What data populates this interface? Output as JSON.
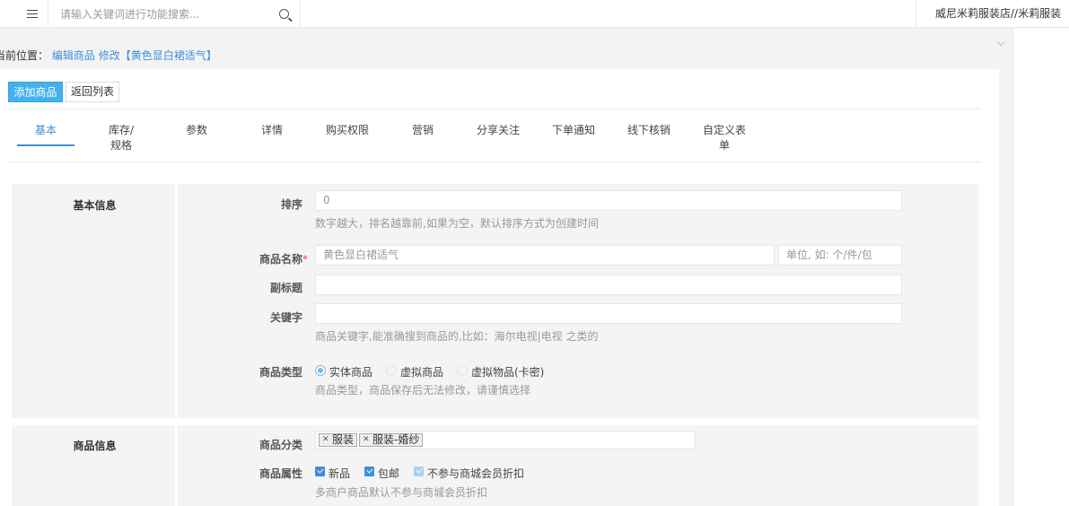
{
  "header": {
    "search_placeholder": "请输入关键词进行功能搜索...",
    "shop_name": "威尼米莉服装店//米莉服装"
  },
  "breadcrumb": {
    "prefix": "当前位置：",
    "link1": "编辑商品",
    "link2": "修改【黄色显白裙适气】"
  },
  "toolbar": {
    "add_label": "添加商品",
    "back_label": "返回列表"
  },
  "tabs": [
    {
      "label": "基本",
      "active": true
    },
    {
      "label": "库存/规格"
    },
    {
      "label": "参数"
    },
    {
      "label": "详情"
    },
    {
      "label": "购买权限"
    },
    {
      "label": "营销"
    },
    {
      "label": "分享关注"
    },
    {
      "label": "下单通知"
    },
    {
      "label": "线下核销"
    },
    {
      "label": "自定义表单"
    }
  ],
  "basic": {
    "title": "基本信息",
    "sort_label": "排序",
    "sort_value": "0",
    "sort_help": "数字越大，排名越靠前,如果为空，默认排序方式为创建时间",
    "name_label": "商品名称",
    "name_required": "*",
    "name_value": "黄色显白裙适气",
    "unit_placeholder": "单位, 如: 个/件/包",
    "subtitle_label": "副标题",
    "subtitle_value": "",
    "keyword_label": "关键字",
    "keyword_value": "",
    "keyword_help": "商品关键字,能准确搜到商品的,比如：海尔电视|电视 之类的",
    "type_label": "商品类型",
    "type_options": [
      "实体商品",
      "虚拟商品",
      "虚拟物品(卡密)"
    ],
    "type_selected": "实体商品",
    "type_help": "商品类型，商品保存后无法修改，请谨慎选择"
  },
  "goods_info": {
    "title": "商品信息",
    "category_label": "商品分类",
    "categories": [
      "服装",
      "服装-婚纱"
    ],
    "attr_label": "商品属性",
    "attrs": [
      "新品",
      "包邮",
      "不参与商城会员折扣"
    ],
    "attr_help": "多商户商品默认不参与商城会员折扣"
  },
  "colors": {
    "accent": "#3f8fd8",
    "button_primary": "#44b1ee",
    "required": "#ee4444"
  }
}
